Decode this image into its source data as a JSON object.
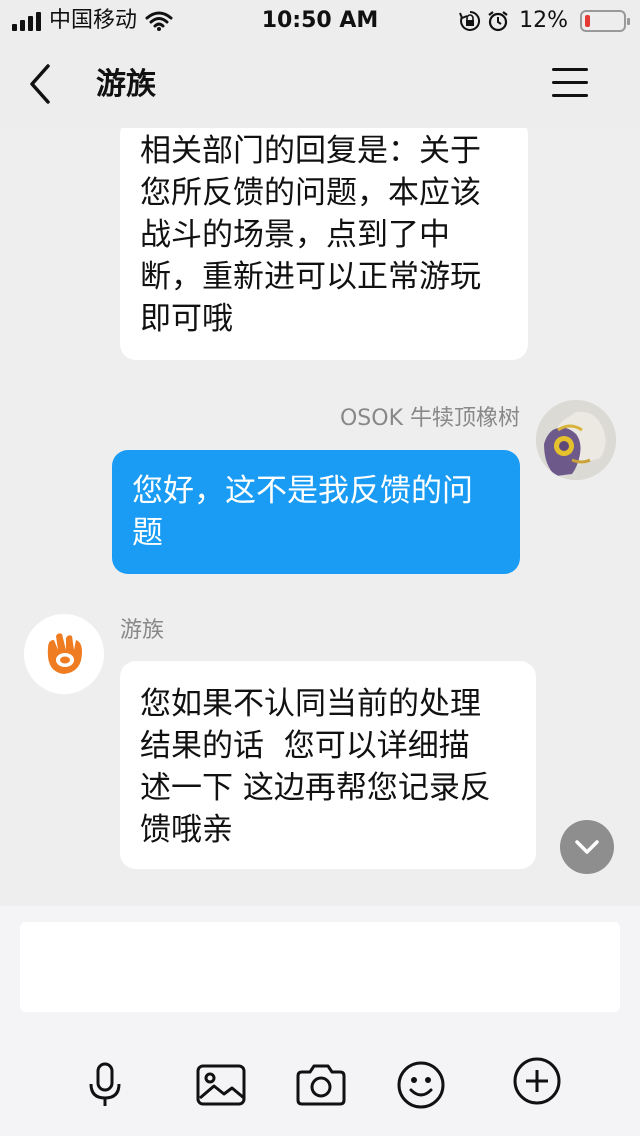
{
  "status_bar": {
    "carrier": "中国移动",
    "time": "10:50 AM",
    "battery_percent": "12%",
    "battery_level": 0.12,
    "battery_color": "#e53935",
    "icons": [
      "signal-icon",
      "wifi-icon",
      "orientation-lock-icon",
      "alarm-icon",
      "battery-icon"
    ]
  },
  "nav": {
    "title": "游族",
    "back_icon": "chevron-left-icon",
    "menu_icon": "hamburger-menu-icon"
  },
  "messages": [
    {
      "direction": "incoming",
      "lines": [
        "相关部门的回复是：关于",
        "您所反馈的问题，本应该",
        "战斗的场景，点到了中",
        "断，重新进可以正常游玩",
        "即可哦"
      ]
    },
    {
      "direction": "outgoing",
      "sender": "OSOK 牛犊顶橡树",
      "lines": [
        "您好，这不是我反馈的问",
        "题"
      ]
    },
    {
      "direction": "incoming",
      "sender": "游族",
      "lines": [
        "您如果不认同当前的处理",
        "结果的话  您可以详细描",
        "述一下 这边再帮您记录反",
        "馈哦亲"
      ]
    }
  ],
  "colors": {
    "outgoing_bubble": "#1a9cf5",
    "incoming_bubble": "#ffffff",
    "brand_logo": "#f07c22"
  },
  "input": {
    "placeholder": "",
    "value": ""
  },
  "toolbar": [
    "microphone-icon",
    "image-icon",
    "camera-icon",
    "emoji-icon",
    "plus-circle-icon"
  ]
}
